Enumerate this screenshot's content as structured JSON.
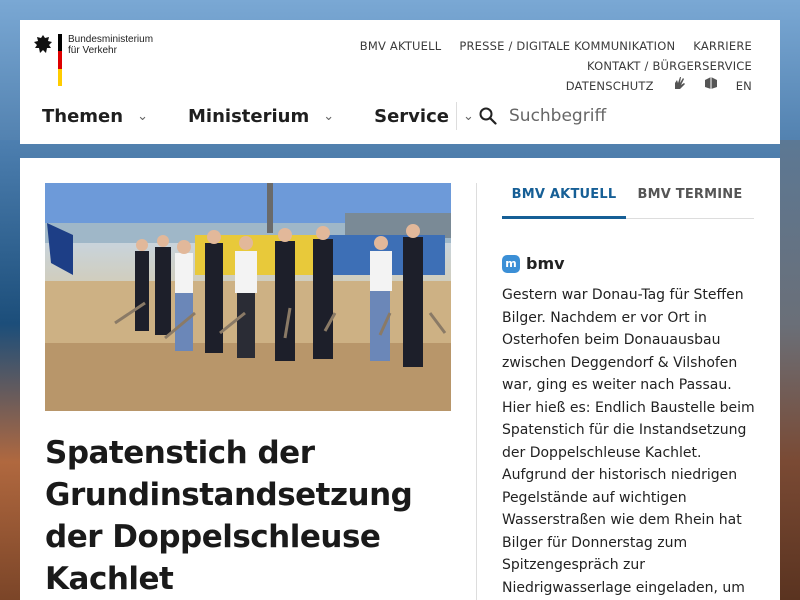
{
  "header": {
    "logo_line1": "Bundesministerium",
    "logo_line2": "für Verkehr",
    "topnav": [
      "BMV AKTUELL",
      "PRESSE / DIGITALE KOMMUNIKATION",
      "KARRIERE",
      "KONTAKT / BÜRGERSERVICE"
    ],
    "topnav_row2": {
      "privacy": "DATENSCHUTZ",
      "sign_language_icon": "sign-language-icon",
      "easy_language_icon": "easy-language-icon",
      "language": "EN"
    },
    "mainnav": [
      "Themen",
      "Ministerium",
      "Service"
    ],
    "search_placeholder": "Suchbegriff"
  },
  "article": {
    "headline": "Spatenstich der Grundinstandsetzung der Doppelschleuse Kachlet"
  },
  "sidebar": {
    "tabs": [
      {
        "label": "BMV AKTUELL",
        "active": true
      },
      {
        "label": "BMV TERMINE",
        "active": false
      }
    ],
    "social_handle": "bmv",
    "post_text": "Gestern war Donau-Tag für Steffen Bilger. Nachdem er vor Ort in Osterhofen beim Donauausbau zwischen Deggendorf & Vilshofen war, ging es weiter nach Passau. Hier hieß es: Endlich Baustelle beim Spatenstich für die Instandsetzung der Doppelschleuse Kachlet. Aufgrund der historisch niedrigen Pegelstände auf wichtigen Wasserstraßen wie dem Rhein hat Bilger für Donnerstag zum Spitzengespräch zur Niedrigwasserlage eingeladen, um"
  },
  "colors": {
    "accent": "#165f96",
    "mastodon": "#3b8fd6"
  }
}
